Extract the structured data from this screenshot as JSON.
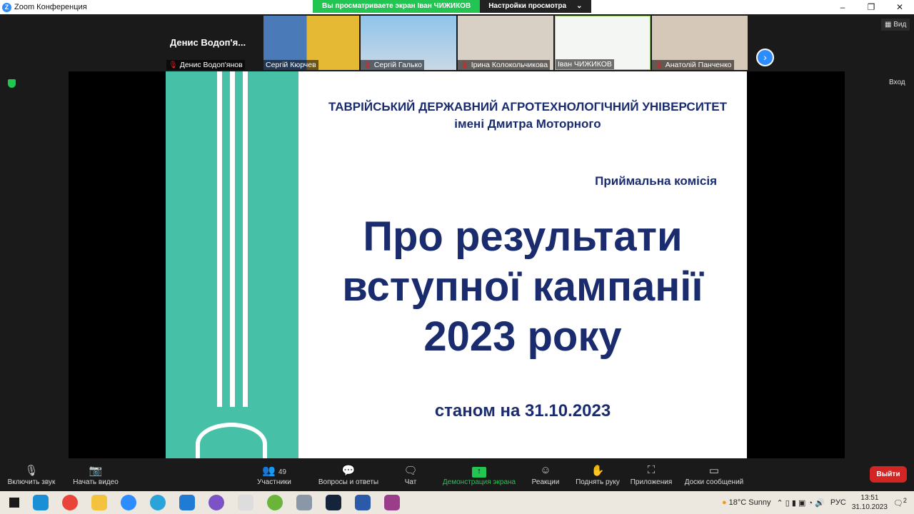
{
  "window": {
    "title": "Zoom Конференция",
    "banner": "Вы просматриваете экран Іван ЧИЖИКОВ",
    "view_settings": "Настройки просмотра"
  },
  "strip": {
    "active_name": "Денис Водоп'я...",
    "view_label": "Вид",
    "participants": [
      {
        "name": "Денис Водоп'янов",
        "muted": true
      },
      {
        "name": "Сергій Кюрчев",
        "muted": false
      },
      {
        "name": "Сергій Галько",
        "muted": true
      },
      {
        "name": "Ірина Колокольчикова",
        "muted": true
      },
      {
        "name": "Іван ЧИЖИКОВ",
        "muted": false
      },
      {
        "name": "Анатолій Панченко",
        "muted": true
      }
    ]
  },
  "enter_label": "Вход",
  "slide": {
    "university": "ТАВРІЙСЬКИЙ ДЕРЖАВНИЙ АГРОТЕХНОЛОГІЧНИЙ УНІВЕРСИТЕТ",
    "named_after": "імені Дмитра Моторного",
    "commission": "Приймальна комісія",
    "title_1": "Про результати",
    "title_2": "вступної кампанії",
    "title_3": "2023 року",
    "date": "станом на 31.10.2023"
  },
  "toolbar": {
    "unmute": "Включить звук",
    "start_video": "Начать видео",
    "participants": "Участники",
    "participants_count": "49",
    "qa": "Вопросы и ответы",
    "chat": "Чат",
    "share": "Демонстрация экрана",
    "reactions": "Реакции",
    "raise_hand": "Поднять руку",
    "apps": "Приложения",
    "whiteboards": "Доски сообщений",
    "leave": "Выйти"
  },
  "taskbar": {
    "weather": "18°C  Sunny",
    "lang": "РУС",
    "time": "13:51",
    "date": "31.10.2023",
    "notifications": "2"
  }
}
